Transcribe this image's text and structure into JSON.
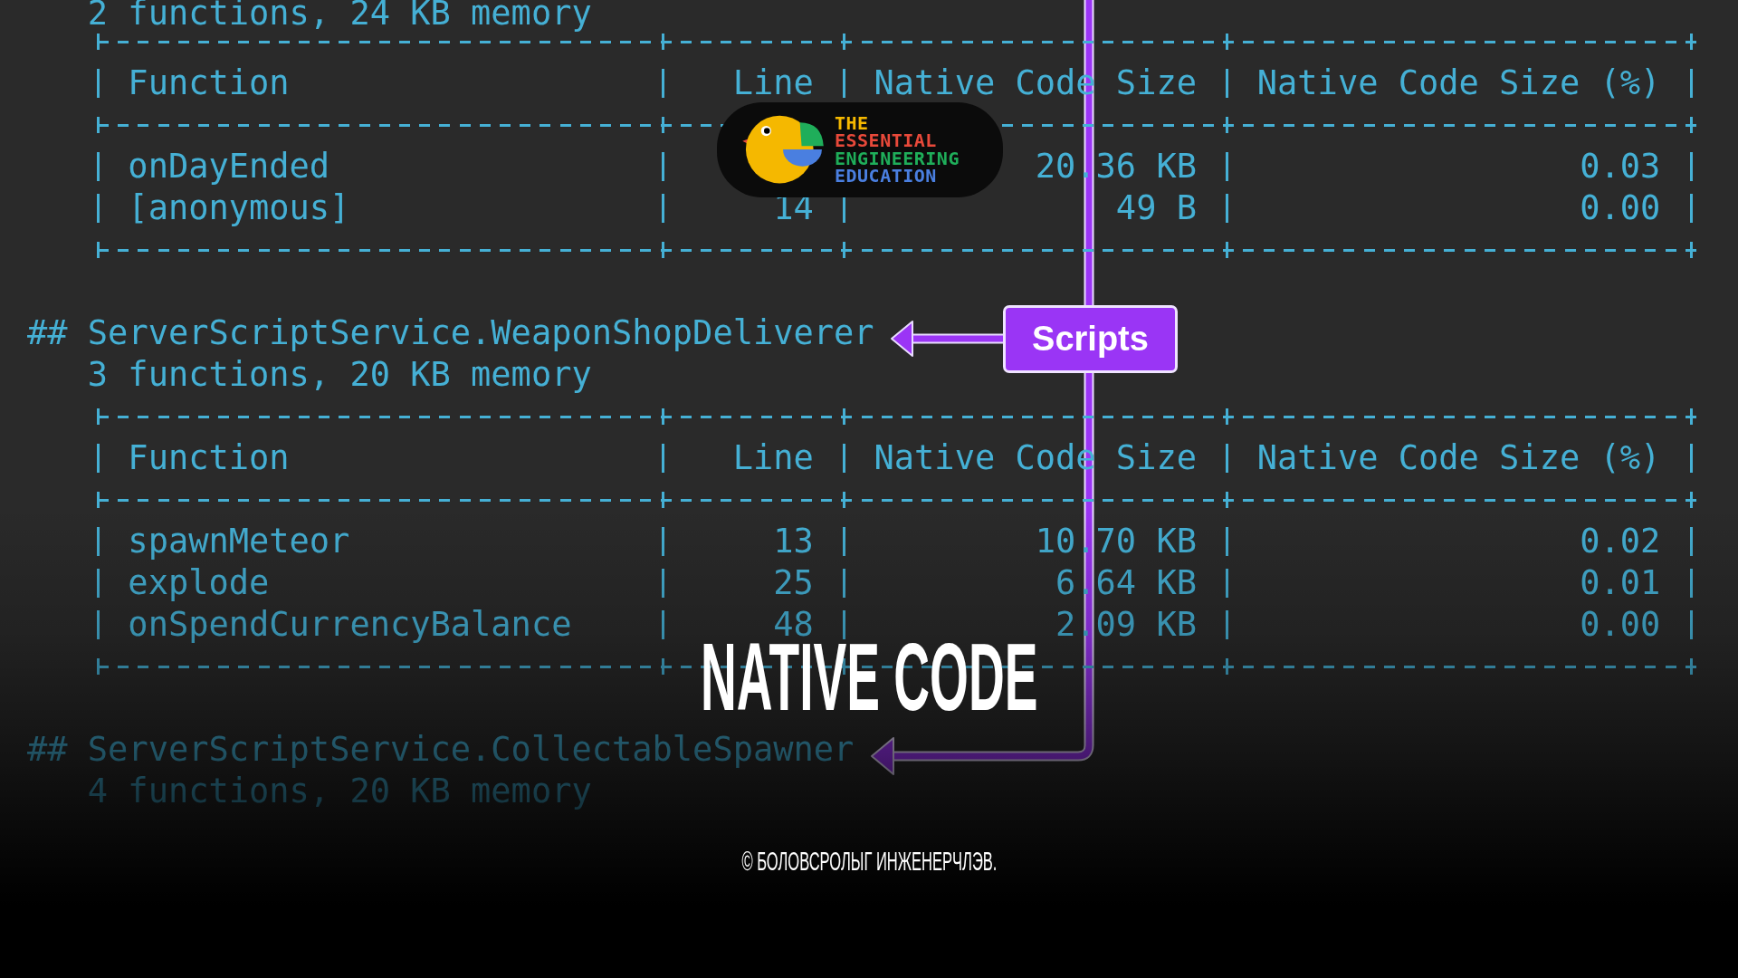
{
  "terminal": {
    "sections": [
      {
        "summary": "2 functions, 24 KB memory",
        "table": {
          "columns": [
            "Function",
            "Line",
            "Native Code Size",
            "Native Code Size (%)"
          ],
          "rows": [
            {
              "function": "onDayEnded",
              "size": "20.36 KB",
              "percent": "0.03"
            },
            {
              "function": "[anonymous]",
              "line": "14",
              "size": "49 B",
              "percent": "0.00"
            }
          ]
        }
      },
      {
        "heading": "## ServerScriptService.WeaponShopDeliverer",
        "summary": "3 functions, 20 KB memory",
        "table": {
          "columns": [
            "Function",
            "Line",
            "Native Code Size",
            "Native Code Size (%)"
          ],
          "rows": [
            {
              "function": "spawnMeteor",
              "line": "13",
              "size": "10.70 KB",
              "percent": "0.02"
            },
            {
              "function": "explode",
              "line": "25",
              "size": "6.64 KB",
              "percent": "0.01"
            },
            {
              "function": "onSpendCurrencyBalance",
              "line": "48",
              "size": "2.09 KB",
              "percent": "0.00"
            }
          ]
        }
      },
      {
        "heading": "## ServerScriptService.CollectableSpawner",
        "summary": "4 functions, 20 KB memory"
      }
    ]
  },
  "logo": {
    "lines": [
      {
        "text": "THE",
        "color": "#f5b800"
      },
      {
        "text": "ESSENTIAL",
        "color": "#e8493a"
      },
      {
        "text": "ENGINEERING",
        "color": "#1fae5a"
      },
      {
        "text": "EDUCATION",
        "color": "#4a7fe0"
      }
    ]
  },
  "annotation": {
    "label": "Scripts"
  },
  "title": "NATIVE CODE",
  "copyright": "© БОЛОВСРОЛЫГ ИНЖЕНЕРЧЛЭВ."
}
